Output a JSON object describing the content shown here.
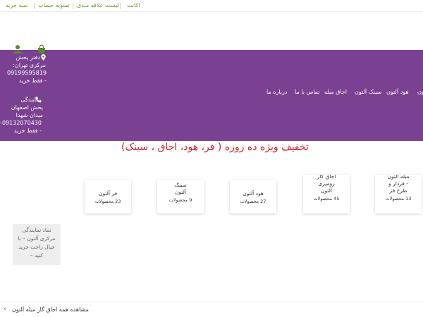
{
  "topbar": {
    "links": [
      "اکانت",
      "لیست علاقه مندی",
      "تسویه حساب",
      "سبد خرید"
    ]
  },
  "contacts": {
    "tehran": [
      "دفتر پخش",
      "مرکزی تهران:",
      "09199595819",
      "- فقط خرید"
    ],
    "isfahan": [
      "نمایندگی",
      "پخش اصفهان",
      "میدان شهدا",
      "09132070430-",
      "- فقط خرید"
    ]
  },
  "nav": {
    "items": [
      "هود آلتون",
      "سینک آلتون",
      "اجاق مبله",
      "تماس با ما",
      "درباره ما"
    ],
    "clipped_right": "ون"
  },
  "promo": {
    "text": "تخفیف ویژه ده روزه ( فر، هود، اجاق ، سینک)"
  },
  "categories": [
    {
      "title": [
        "فر آلتون"
      ],
      "count": "23 محصولات"
    },
    {
      "title": [
        "سینک",
        "آلتون"
      ],
      "count": "9 محصولات"
    },
    {
      "title": [
        "هود آلتون"
      ],
      "count": "27 محصولات"
    },
    {
      "title": [
        "اجاق گاز",
        "رومیزی",
        "آلتون"
      ],
      "count": "45 محصولات"
    },
    {
      "title": [
        "مبله آلتون",
        "- فردار و",
        "طرح فر"
      ],
      "count": "13 محصولات"
    }
  ],
  "agency_box": {
    "lines": [
      "نماد نمایندگی",
      "مرکزی آلتون – با",
      "خیال راحت خرید",
      "کنید –"
    ]
  },
  "view_all": {
    "text": "مشاهده همه اجاق گاز مبله آلتون"
  },
  "colors": {
    "purple": "#7a4192",
    "accent_green": "#6f9a2f",
    "promo_red": "#d3242d"
  }
}
